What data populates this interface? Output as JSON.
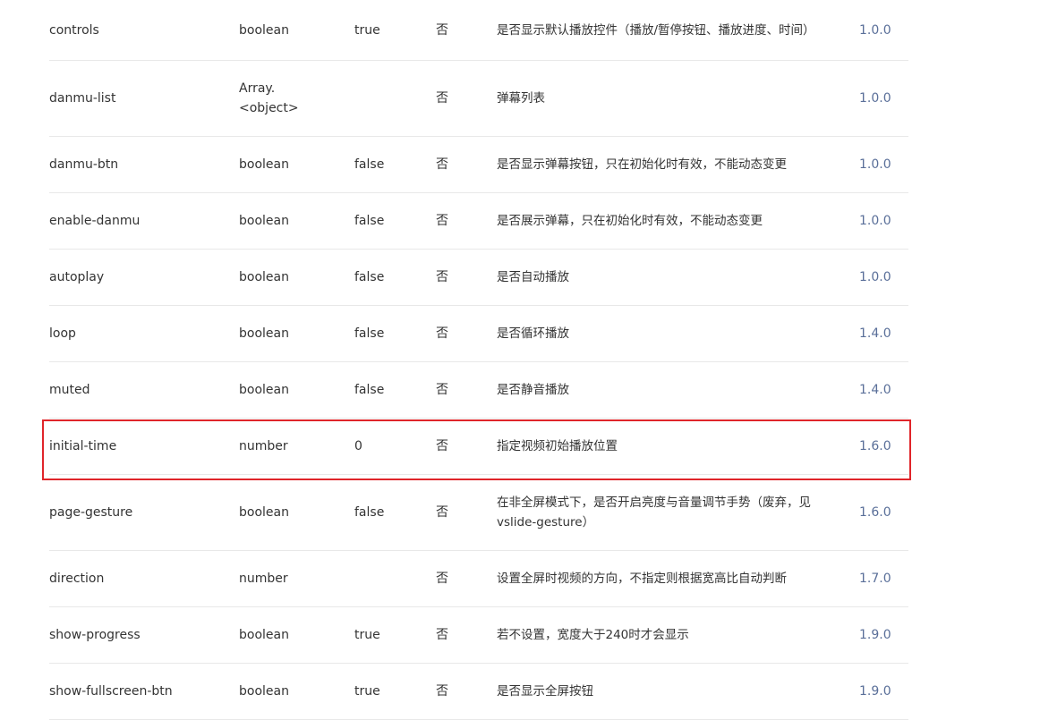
{
  "rows": [
    {
      "name": "controls",
      "type": "boolean",
      "default": "true",
      "required": "否",
      "desc": "是否显示默认播放控件（播放/暂停按钮、播放进度、时间）",
      "version": "1.0.0"
    },
    {
      "name": "danmu-list",
      "type": "Array.<object>",
      "type_line1": "Array.",
      "type_line2": "<object>",
      "default": "",
      "required": "否",
      "desc": "弹幕列表",
      "version": "1.0.0"
    },
    {
      "name": "danmu-btn",
      "type": "boolean",
      "default": "false",
      "required": "否",
      "desc": "是否显示弹幕按钮，只在初始化时有效，不能动态变更",
      "version": "1.0.0"
    },
    {
      "name": "enable-danmu",
      "type": "boolean",
      "default": "false",
      "required": "否",
      "desc": "是否展示弹幕，只在初始化时有效，不能动态变更",
      "version": "1.0.0"
    },
    {
      "name": "autoplay",
      "type": "boolean",
      "default": "false",
      "required": "否",
      "desc": "是否自动播放",
      "version": "1.0.0"
    },
    {
      "name": "loop",
      "type": "boolean",
      "default": "false",
      "required": "否",
      "desc": "是否循环播放",
      "version": "1.4.0"
    },
    {
      "name": "muted",
      "type": "boolean",
      "default": "false",
      "required": "否",
      "desc": "是否静音播放",
      "version": "1.4.0"
    },
    {
      "name": "initial-time",
      "type": "number",
      "default": "0",
      "required": "否",
      "desc": "指定视频初始播放位置",
      "version": "1.6.0"
    },
    {
      "name": "page-gesture",
      "type": "boolean",
      "default": "false",
      "required": "否",
      "desc": "在非全屏模式下，是否开启亮度与音量调节手势（废弃，见vslide-gesture）",
      "version": "1.6.0"
    },
    {
      "name": "direction",
      "type": "number",
      "default": "",
      "required": "否",
      "desc": "设置全屏时视频的方向，不指定则根据宽高比自动判断",
      "version": "1.7.0"
    },
    {
      "name": "show-progress",
      "type": "boolean",
      "default": "true",
      "required": "否",
      "desc": "若不设置，宽度大于240时才会显示",
      "version": "1.9.0"
    },
    {
      "name": "show-fullscreen-btn",
      "type": "boolean",
      "default": "true",
      "required": "否",
      "desc": "是否显示全屏按钮",
      "version": "1.9.0"
    }
  ],
  "highlight": {
    "row_name": "initial-time",
    "color": "#e0252a"
  },
  "colors": {
    "version_link": "#5a6f99",
    "text": "#333333",
    "divider": "#e8e8e8"
  }
}
